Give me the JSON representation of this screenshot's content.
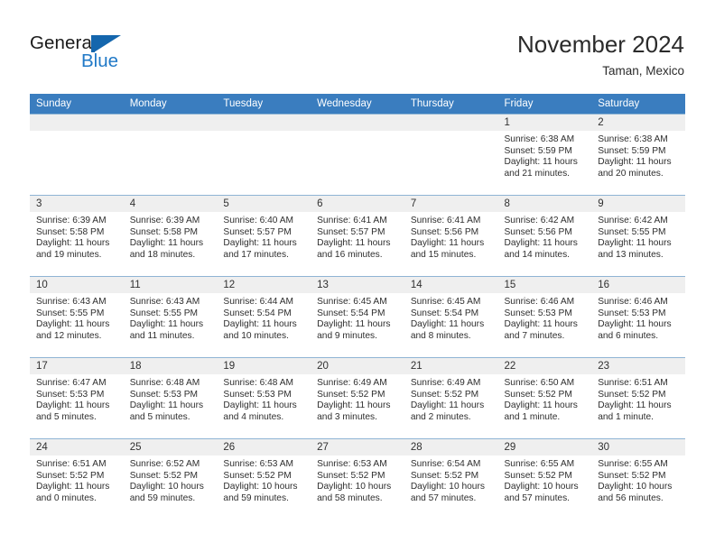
{
  "brand": {
    "name_part1": "General",
    "name_part2": "Blue",
    "triangle_color": "#1466ad",
    "blue_text_color": "#2079c7"
  },
  "header": {
    "title": "November 2024",
    "location": "Taman, Mexico"
  },
  "theme": {
    "header_row_bg": "#3a7dbf",
    "day_number_bg": "#efefef",
    "grid_line": "#8fb4d4",
    "text": "#2e2e2e"
  },
  "calendar": {
    "weekday_headers": [
      "Sunday",
      "Monday",
      "Tuesday",
      "Wednesday",
      "Thursday",
      "Friday",
      "Saturday"
    ],
    "weeks": [
      [
        {
          "day": "",
          "blank": true
        },
        {
          "day": "",
          "blank": true
        },
        {
          "day": "",
          "blank": true
        },
        {
          "day": "",
          "blank": true
        },
        {
          "day": "",
          "blank": true
        },
        {
          "day": "1",
          "sunrise": "Sunrise: 6:38 AM",
          "sunset": "Sunset: 5:59 PM",
          "daylight": "Daylight: 11 hours and 21 minutes."
        },
        {
          "day": "2",
          "sunrise": "Sunrise: 6:38 AM",
          "sunset": "Sunset: 5:59 PM",
          "daylight": "Daylight: 11 hours and 20 minutes."
        }
      ],
      [
        {
          "day": "3",
          "sunrise": "Sunrise: 6:39 AM",
          "sunset": "Sunset: 5:58 PM",
          "daylight": "Daylight: 11 hours and 19 minutes."
        },
        {
          "day": "4",
          "sunrise": "Sunrise: 6:39 AM",
          "sunset": "Sunset: 5:58 PM",
          "daylight": "Daylight: 11 hours and 18 minutes."
        },
        {
          "day": "5",
          "sunrise": "Sunrise: 6:40 AM",
          "sunset": "Sunset: 5:57 PM",
          "daylight": "Daylight: 11 hours and 17 minutes."
        },
        {
          "day": "6",
          "sunrise": "Sunrise: 6:41 AM",
          "sunset": "Sunset: 5:57 PM",
          "daylight": "Daylight: 11 hours and 16 minutes."
        },
        {
          "day": "7",
          "sunrise": "Sunrise: 6:41 AM",
          "sunset": "Sunset: 5:56 PM",
          "daylight": "Daylight: 11 hours and 15 minutes."
        },
        {
          "day": "8",
          "sunrise": "Sunrise: 6:42 AM",
          "sunset": "Sunset: 5:56 PM",
          "daylight": "Daylight: 11 hours and 14 minutes."
        },
        {
          "day": "9",
          "sunrise": "Sunrise: 6:42 AM",
          "sunset": "Sunset: 5:55 PM",
          "daylight": "Daylight: 11 hours and 13 minutes."
        }
      ],
      [
        {
          "day": "10",
          "sunrise": "Sunrise: 6:43 AM",
          "sunset": "Sunset: 5:55 PM",
          "daylight": "Daylight: 11 hours and 12 minutes."
        },
        {
          "day": "11",
          "sunrise": "Sunrise: 6:43 AM",
          "sunset": "Sunset: 5:55 PM",
          "daylight": "Daylight: 11 hours and 11 minutes."
        },
        {
          "day": "12",
          "sunrise": "Sunrise: 6:44 AM",
          "sunset": "Sunset: 5:54 PM",
          "daylight": "Daylight: 11 hours and 10 minutes."
        },
        {
          "day": "13",
          "sunrise": "Sunrise: 6:45 AM",
          "sunset": "Sunset: 5:54 PM",
          "daylight": "Daylight: 11 hours and 9 minutes."
        },
        {
          "day": "14",
          "sunrise": "Sunrise: 6:45 AM",
          "sunset": "Sunset: 5:54 PM",
          "daylight": "Daylight: 11 hours and 8 minutes."
        },
        {
          "day": "15",
          "sunrise": "Sunrise: 6:46 AM",
          "sunset": "Sunset: 5:53 PM",
          "daylight": "Daylight: 11 hours and 7 minutes."
        },
        {
          "day": "16",
          "sunrise": "Sunrise: 6:46 AM",
          "sunset": "Sunset: 5:53 PM",
          "daylight": "Daylight: 11 hours and 6 minutes."
        }
      ],
      [
        {
          "day": "17",
          "sunrise": "Sunrise: 6:47 AM",
          "sunset": "Sunset: 5:53 PM",
          "daylight": "Daylight: 11 hours and 5 minutes."
        },
        {
          "day": "18",
          "sunrise": "Sunrise: 6:48 AM",
          "sunset": "Sunset: 5:53 PM",
          "daylight": "Daylight: 11 hours and 5 minutes."
        },
        {
          "day": "19",
          "sunrise": "Sunrise: 6:48 AM",
          "sunset": "Sunset: 5:53 PM",
          "daylight": "Daylight: 11 hours and 4 minutes."
        },
        {
          "day": "20",
          "sunrise": "Sunrise: 6:49 AM",
          "sunset": "Sunset: 5:52 PM",
          "daylight": "Daylight: 11 hours and 3 minutes."
        },
        {
          "day": "21",
          "sunrise": "Sunrise: 6:49 AM",
          "sunset": "Sunset: 5:52 PM",
          "daylight": "Daylight: 11 hours and 2 minutes."
        },
        {
          "day": "22",
          "sunrise": "Sunrise: 6:50 AM",
          "sunset": "Sunset: 5:52 PM",
          "daylight": "Daylight: 11 hours and 1 minute."
        },
        {
          "day": "23",
          "sunrise": "Sunrise: 6:51 AM",
          "sunset": "Sunset: 5:52 PM",
          "daylight": "Daylight: 11 hours and 1 minute."
        }
      ],
      [
        {
          "day": "24",
          "sunrise": "Sunrise: 6:51 AM",
          "sunset": "Sunset: 5:52 PM",
          "daylight": "Daylight: 11 hours and 0 minutes."
        },
        {
          "day": "25",
          "sunrise": "Sunrise: 6:52 AM",
          "sunset": "Sunset: 5:52 PM",
          "daylight": "Daylight: 10 hours and 59 minutes."
        },
        {
          "day": "26",
          "sunrise": "Sunrise: 6:53 AM",
          "sunset": "Sunset: 5:52 PM",
          "daylight": "Daylight: 10 hours and 59 minutes."
        },
        {
          "day": "27",
          "sunrise": "Sunrise: 6:53 AM",
          "sunset": "Sunset: 5:52 PM",
          "daylight": "Daylight: 10 hours and 58 minutes."
        },
        {
          "day": "28",
          "sunrise": "Sunrise: 6:54 AM",
          "sunset": "Sunset: 5:52 PM",
          "daylight": "Daylight: 10 hours and 57 minutes."
        },
        {
          "day": "29",
          "sunrise": "Sunrise: 6:55 AM",
          "sunset": "Sunset: 5:52 PM",
          "daylight": "Daylight: 10 hours and 57 minutes."
        },
        {
          "day": "30",
          "sunrise": "Sunrise: 6:55 AM",
          "sunset": "Sunset: 5:52 PM",
          "daylight": "Daylight: 10 hours and 56 minutes."
        }
      ]
    ]
  }
}
